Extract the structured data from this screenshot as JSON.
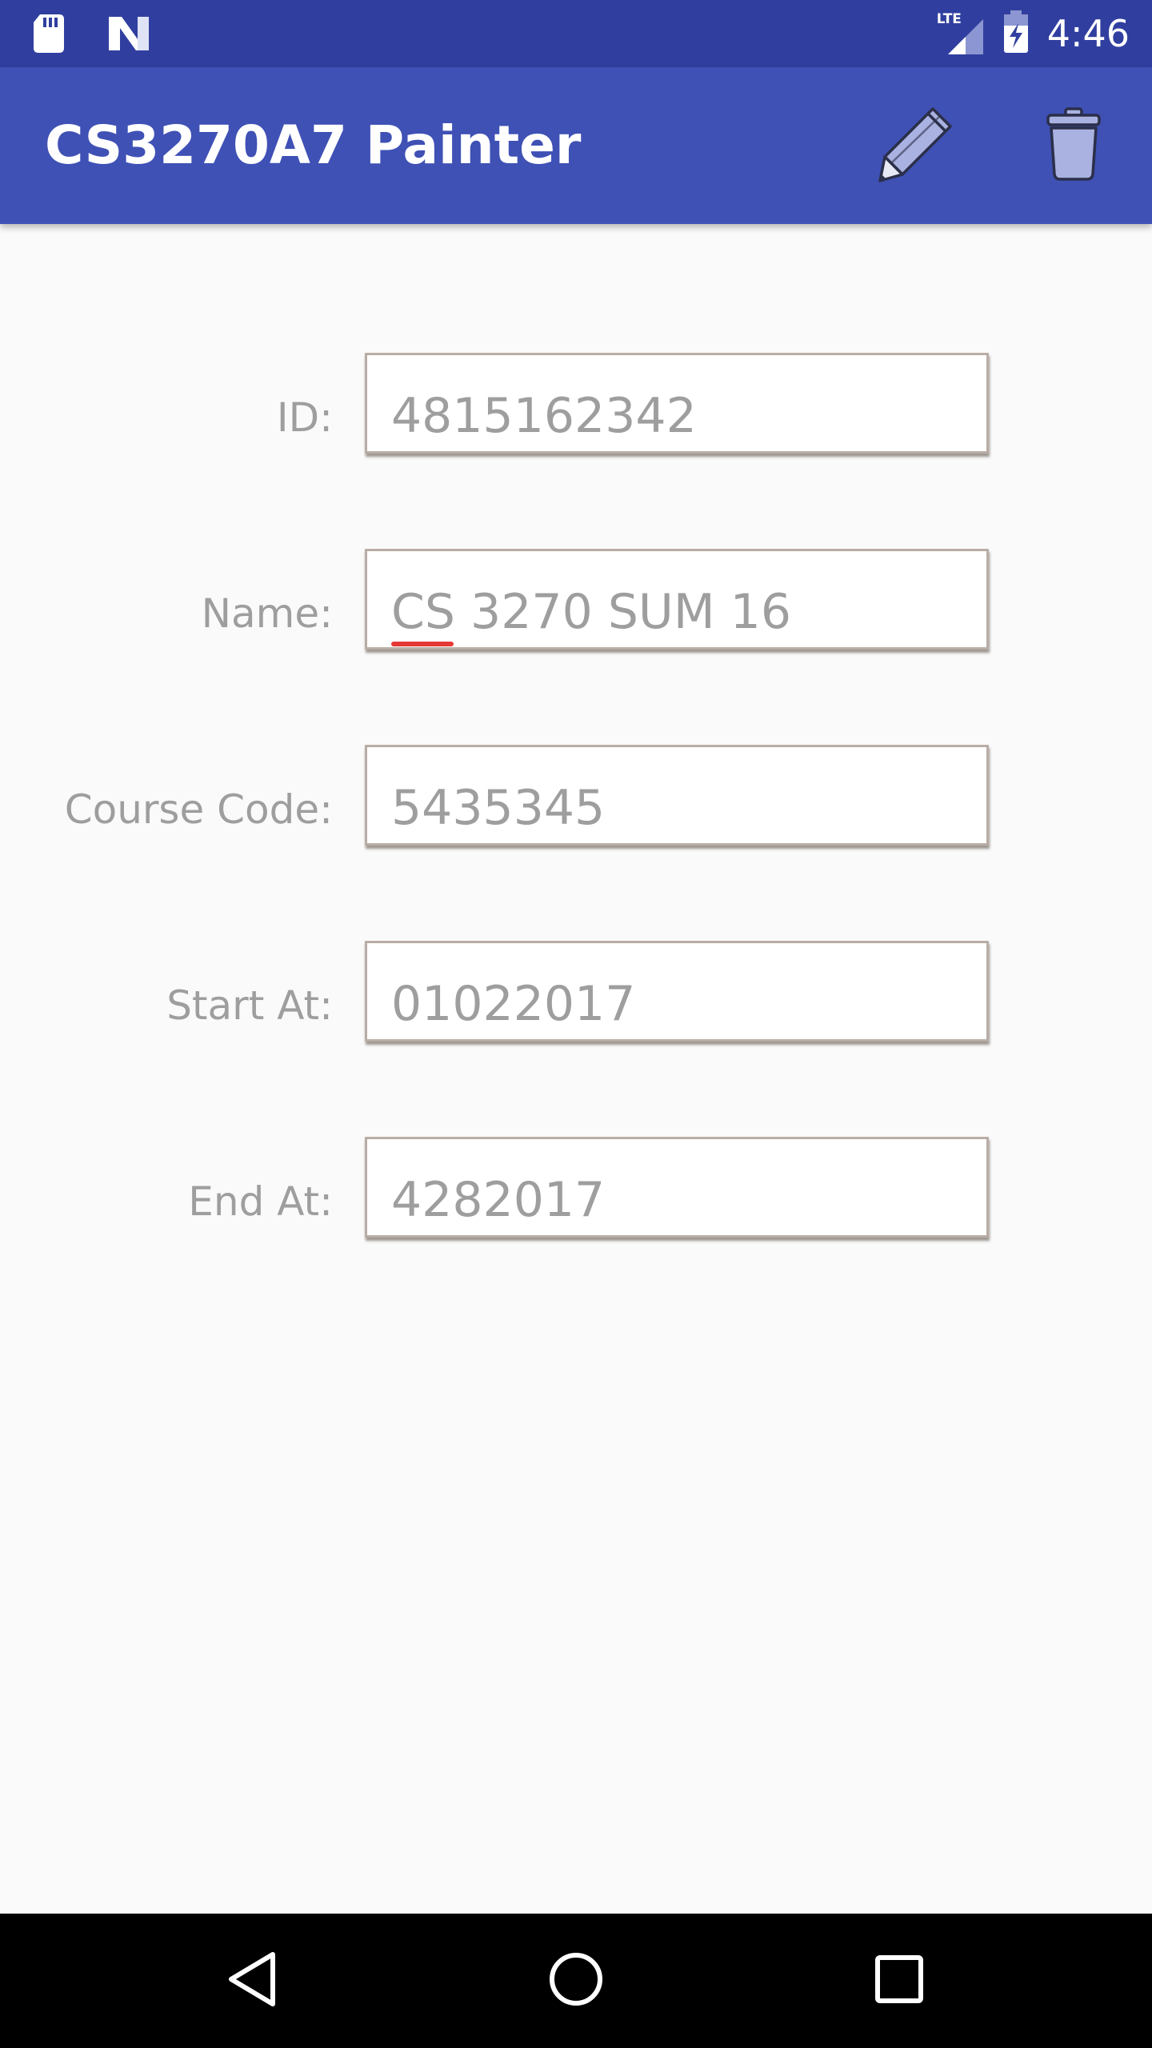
{
  "status_bar": {
    "time": "4:46",
    "network_label": "LTE",
    "icons": [
      "sd-card-icon",
      "notification-n-icon",
      "lte-signal-icon",
      "battery-charging-icon"
    ]
  },
  "app_bar": {
    "title": "CS3270A7 Painter",
    "actions": [
      "pencil-icon",
      "trash-icon"
    ],
    "colors": {
      "app_bar": "#3f51b5",
      "status_bar": "#303f9f"
    }
  },
  "form": {
    "fields": [
      {
        "label": "ID:",
        "value": "4815162342"
      },
      {
        "label": "Name:",
        "value": "CS 3270 SUM 16"
      },
      {
        "label": "Course Code:",
        "value": "5435345"
      },
      {
        "label": "Start At:",
        "value": "01022017"
      },
      {
        "label": "End At:",
        "value": "4282017"
      }
    ]
  },
  "nav_bar": {
    "buttons": [
      "back-triangle-icon",
      "home-circle-icon",
      "recents-square-icon"
    ]
  }
}
